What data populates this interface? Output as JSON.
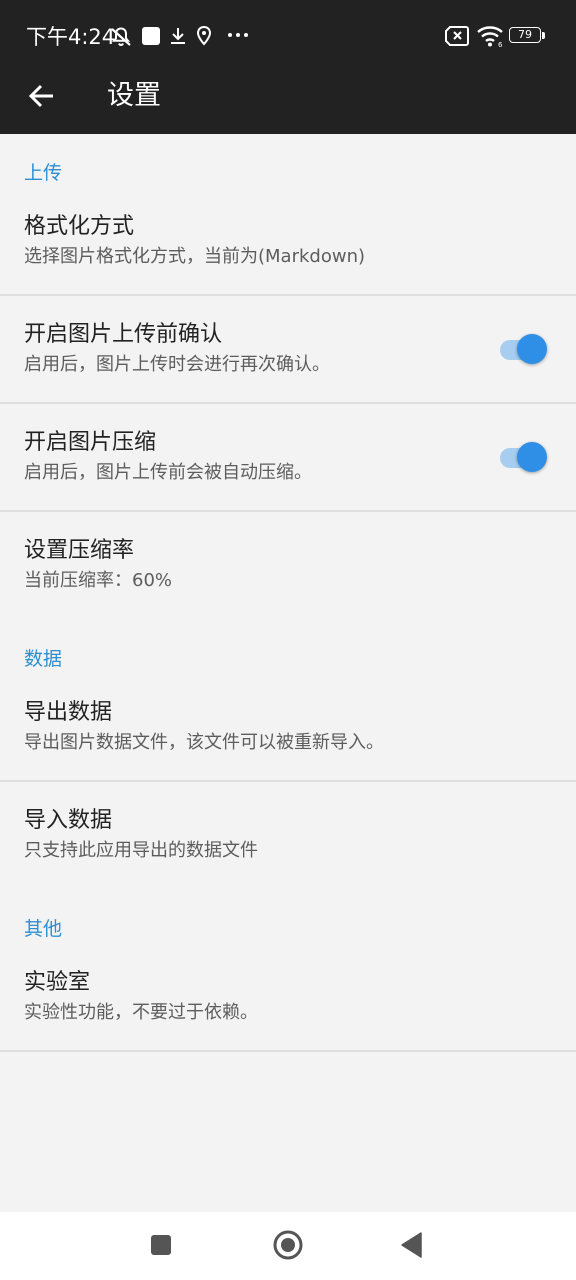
{
  "status_bar": {
    "time": "下午4:24",
    "battery_level": "79",
    "left_icons": [
      "notifications-off-icon",
      "square-notification-icon",
      "download-icon",
      "location-pin-icon",
      "more-dots-icon"
    ],
    "right_icons": [
      "sim-missing-icon",
      "wifi-icon",
      "battery-icon"
    ]
  },
  "appbar": {
    "title": "设置",
    "back_icon": "arrow-left-icon"
  },
  "sections": {
    "upload": {
      "header": "上传",
      "format": {
        "title": "格式化方式",
        "summary": "选择图片格式化方式，当前为(Markdown)"
      },
      "confirm": {
        "title": "开启图片上传前确认",
        "summary": "启用后，图片上传时会进行再次确认。",
        "enabled": true
      },
      "compress": {
        "title": "开启图片压缩",
        "summary": "启用后，图片上传前会被自动压缩。",
        "enabled": true
      },
      "ratio": {
        "title": "设置压缩率",
        "summary": "当前压缩率：60%"
      }
    },
    "data": {
      "header": "数据",
      "export": {
        "title": "导出数据",
        "summary": "导出图片数据文件，该文件可以被重新导入。"
      },
      "import": {
        "title": "导入数据",
        "summary": "只支持此应用导出的数据文件"
      }
    },
    "other": {
      "header": "其他",
      "lab": {
        "title": "实验室",
        "summary": "实验性功能，不要过于依赖。"
      }
    }
  },
  "navigation_bar": {
    "icons": [
      "recents-square-icon",
      "home-circle-icon",
      "back-triangle-icon"
    ]
  },
  "colors": {
    "topbar": "#222222",
    "accent": "#2d8fd2",
    "switch_thumb": "#2f8fe6",
    "switch_track": "#a7cdf1",
    "background": "#f3f3f3"
  }
}
